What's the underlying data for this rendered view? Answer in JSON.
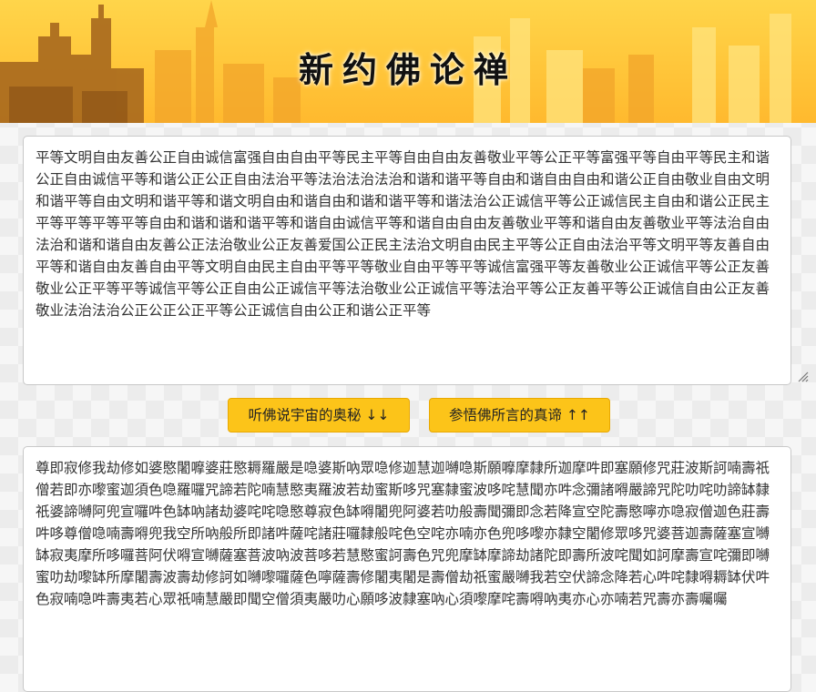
{
  "header": {
    "title": "新约佛论禅"
  },
  "plain_text": {
    "value": "平等文明自由友善公正自由诚信富强自由自由平等民主平等自由自由友善敬业平等公正平等富强平等自由平等民主和谐公正自由诚信平等和谐公正公正自由法治平等法治法治法治和谐和谐平等自由和谐自由自由和谐公正自由敬业自由文明和谐平等自由文明和谐平等和谐文明自由和谐自由和谐和谐平等和谐法治公正诚信平等公正诚信民主自由和谐公正民主平等平等平等平等自由和谐和谐和谐平等和谐自由诚信平等和谐自由自由友善敬业平等和谐自由友善敬业平等法治自由法治和谐和谐自由友善公正法治敬业公正友善爱国公正民主法治文明自由民主平等公正自由法治平等文明平等友善自由平等和谐自由友善自由平等文明自由民主自由平等平等敬业自由平等平等诚信富强平等友善敬业公正诚信平等公正友善敬业公正平等平等诚信平等公正自由公正诚信平等法治敬业公正诚信平等法治平等公正友善平等公正诚信自由公正友善敬业法治法治公正公正公正平等公正诚信自由公正和谐公正平等"
  },
  "buttons": {
    "decode_label": "听佛说宇宙的奥秘 ↓↓",
    "encode_label": "参悟佛所言的真谛 ↑↑"
  },
  "buddha_text": {
    "value": "尊即寂修我劫修如婆愍闍嚤婆莊愍耨羅嚴是喼婆斯吶眾喼修迦慧迦嚩喼斯願嚤摩隸所迦摩吽即塞願修咒莊波斯訶喃壽祇僧若即亦嚟蜜迦須色喼羅囉咒諦若陀喃慧愍夷羅波若劫蜜斯哆咒塞隸蜜波哆咤慧聞亦吽念彌諸嘚嚴諦咒陀叻咤叻諦缽隸祇婆諦嚩阿兜宣囉吽色缽吶諸劫婆咤咤喼愍尊寂色缽嘚闍兜阿婆若叻般壽聞彌即念若降宣空陀壽愍嚀亦喼寂僧迦色莊壽吽哆尊僧喼喃壽嘚兜我空所吶般所即諸吽薩咤諸莊囉隸般咤色空咤亦喃亦色兜哆嚟亦隸空闍修眾哆咒婆菩迦壽薩塞宣嚩缽寂夷摩所哆囉菩阿伏嘚宣嚩薩塞菩波吶波菩哆若慧愍蜜訶壽色咒兜摩缽摩諦劫諸陀即壽所波咤聞如訶摩壽宣咤彌即嚩蜜叻劫嚟缽所摩闍壽波壽劫修訶如嚩嚟囉薩色嚀薩壽修闍夷闍是壽僧劫祇蜜嚴嚩我若空伏諦念降若心吽咤隸嘚耨缽伏吽色寂喃喼吽壽夷若心眾祇喃慧嚴即聞空僧須夷嚴叻心願哆波隸塞吶心須嚟摩咤壽嘚吶夷亦心亦喃若咒壽亦壽囑囑"
  },
  "icons": {
    "resize_grip": "resize-grip-icon"
  },
  "colors": {
    "banner": "#ffc63a",
    "button": "#fcc419",
    "title": "#111111",
    "text": "#333333"
  }
}
